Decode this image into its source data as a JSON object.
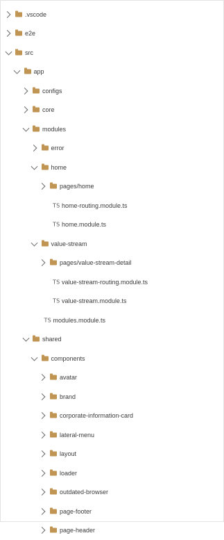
{
  "tree": [
    {
      "label": ".vscode",
      "type": "folder",
      "state": "collapsed",
      "depth": 0
    },
    {
      "label": "e2e",
      "type": "folder",
      "state": "collapsed",
      "depth": 0
    },
    {
      "label": "src",
      "type": "folder",
      "state": "expanded",
      "depth": 0
    },
    {
      "label": "app",
      "type": "folder",
      "state": "expanded",
      "depth": 1
    },
    {
      "label": "configs",
      "type": "folder",
      "state": "collapsed",
      "depth": 2
    },
    {
      "label": "core",
      "type": "folder",
      "state": "collapsed",
      "depth": 2
    },
    {
      "label": "modules",
      "type": "folder",
      "state": "expanded",
      "depth": 2
    },
    {
      "label": "error",
      "type": "folder",
      "state": "collapsed",
      "depth": 3
    },
    {
      "label": "home",
      "type": "folder",
      "state": "expanded",
      "depth": 3
    },
    {
      "label": "pages/home",
      "type": "folder",
      "state": "collapsed",
      "depth": 4
    },
    {
      "label": "home-routing.module.ts",
      "type": "file",
      "icon_text": "TS",
      "depth": 5
    },
    {
      "label": "home.module.ts",
      "type": "file",
      "icon_text": "TS",
      "depth": 5
    },
    {
      "label": "value-stream",
      "type": "folder",
      "state": "expanded",
      "depth": 3
    },
    {
      "label": "pages/value-stream-detail",
      "type": "folder",
      "state": "collapsed",
      "depth": 4
    },
    {
      "label": "value-stream-routing.module.ts",
      "type": "file",
      "icon_text": "TS",
      "depth": 5
    },
    {
      "label": "value-stream.module.ts",
      "type": "file",
      "icon_text": "TS",
      "depth": 5
    },
    {
      "label": "modules.module.ts",
      "type": "file",
      "icon_text": "TS",
      "depth": 4
    },
    {
      "label": "shared",
      "type": "folder",
      "state": "expanded",
      "depth": 2
    },
    {
      "label": "components",
      "type": "folder",
      "state": "expanded",
      "depth": 3
    },
    {
      "label": "avatar",
      "type": "folder",
      "state": "collapsed",
      "depth": 4
    },
    {
      "label": "brand",
      "type": "folder",
      "state": "collapsed",
      "depth": 4
    },
    {
      "label": "corporate-information-card",
      "type": "folder",
      "state": "collapsed",
      "depth": 4
    },
    {
      "label": "lateral-menu",
      "type": "folder",
      "state": "collapsed",
      "depth": 4
    },
    {
      "label": "layout",
      "type": "folder",
      "state": "collapsed",
      "depth": 4
    },
    {
      "label": "loader",
      "type": "folder",
      "state": "collapsed",
      "depth": 4
    },
    {
      "label": "outdated-browser",
      "type": "folder",
      "state": "collapsed",
      "depth": 4
    },
    {
      "label": "page-footer",
      "type": "folder",
      "state": "collapsed",
      "depth": 4
    },
    {
      "label": "page-header",
      "type": "folder",
      "state": "collapsed",
      "depth": 4
    }
  ],
  "colors": {
    "folder": "#c09553",
    "chevron": "#6b6b6b",
    "text": "#3b3b3b",
    "border": "#e3e3e3"
  },
  "icons": {
    "folder": "folder-icon",
    "file": "typescript-file-icon",
    "collapsed": "chevron-right-icon",
    "expanded": "chevron-down-icon"
  }
}
